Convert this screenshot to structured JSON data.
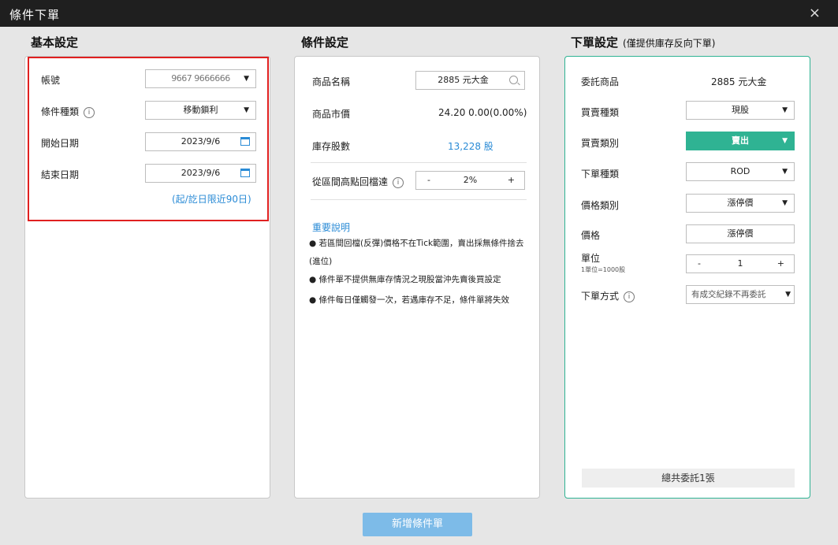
{
  "window": {
    "title": "條件下單",
    "close": "×"
  },
  "basic": {
    "title": "基本設定",
    "account_label": "帳號",
    "account_value": "9667 9666666",
    "condition_type_label": "條件種類",
    "condition_type_value": "移動鎖利",
    "start_date_label": "開始日期",
    "start_date_value": "2023/9/6",
    "end_date_label": "結束日期",
    "end_date_value": "2023/9/6",
    "range_note": "(起/訖日限近90日)"
  },
  "condition": {
    "title": "條件設定",
    "product_name_label": "商品名稱",
    "product_name_value": "2885 元大金",
    "market_price_label": "商品市價",
    "market_price_value": "24.20  0.00(0.00%)",
    "inventory_label": "庫存股數",
    "inventory_value": "13,228 股",
    "pullback_label": "從區間高點回檔達",
    "pullback_minus": "-",
    "pullback_value": "2%",
    "pullback_plus": "+",
    "notes_title": "重要說明",
    "notes": [
      "● 若區間回檔(反彈)價格不在Tick範圍，賣出採無條件捨去(進位)",
      "● 條件單不提供無庫存情況之現股當沖先賣後買設定",
      "● 條件每日僅觸發一次，若遇庫存不足，條件單將失效"
    ]
  },
  "order": {
    "title": "下單設定",
    "title_note": "(僅提供庫存反向下單)",
    "product_label": "委託商品",
    "product_value": "2885 元大金",
    "trade_type_label": "買賣種類",
    "trade_type_value": "現股",
    "side_label": "買賣類別",
    "side_value": "賣出",
    "order_type_label": "下單種類",
    "order_type_value": "ROD",
    "price_type_label": "價格類別",
    "price_type_value": "漲停價",
    "price_label": "價格",
    "price_value": "漲停價",
    "unit_label": "單位",
    "unit_sub": "1單位=1000股",
    "unit_minus": "-",
    "unit_value": "1",
    "unit_plus": "+",
    "method_label": "下單方式",
    "method_value": "有成交紀錄不再委託",
    "total": "總共委託1張"
  },
  "submit_label": "新增條件單",
  "icons": {
    "dropdown": "▼",
    "info": "i",
    "calendar": "calendar-icon",
    "search": "search-icon"
  },
  "colors": {
    "accent_green": "#2fb393",
    "link_blue": "#2a8bd6",
    "highlight_red": "#e02020",
    "submit_blue": "#7dbbe8"
  }
}
